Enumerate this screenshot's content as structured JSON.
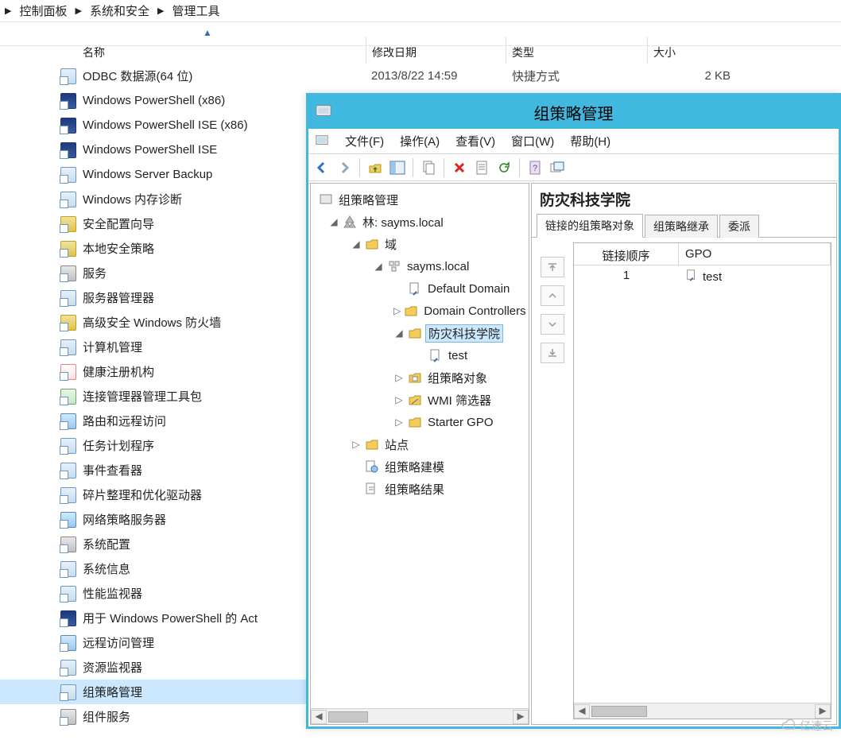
{
  "breadcrumb": [
    "控制面板",
    "系统和安全",
    "管理工具"
  ],
  "explorer": {
    "columns": {
      "name": "名称",
      "date": "修改日期",
      "type": "类型",
      "size": "大小"
    },
    "first_visible_row": {
      "name": "ODBC 数据源(64 位)",
      "date": "2013/8/22 14:59",
      "type": "快捷方式",
      "size": "2 KB"
    },
    "items": [
      "ODBC 数据源(64 位)",
      "Windows PowerShell (x86)",
      "Windows PowerShell ISE (x86)",
      "Windows PowerShell ISE",
      "Windows Server Backup",
      "Windows 内存诊断",
      "安全配置向导",
      "本地安全策略",
      "服务",
      "服务器管理器",
      "高级安全 Windows 防火墙",
      "计算机管理",
      "健康注册机构",
      "连接管理器管理工具包",
      "路由和远程访问",
      "任务计划程序",
      "事件查看器",
      "碎片整理和优化驱动器",
      "网络策略服务器",
      "系统配置",
      "系统信息",
      "性能监视器",
      "用于 Windows PowerShell 的 Act",
      "远程访问管理",
      "资源监视器",
      "组策略管理",
      "组件服务"
    ],
    "selected_index": 25
  },
  "gpmc": {
    "title": "组策略管理",
    "menu": {
      "file": "文件(F)",
      "action": "操作(A)",
      "view": "查看(V)",
      "window": "窗口(W)",
      "help": "帮助(H)"
    },
    "tree": {
      "root": "组策略管理",
      "forest": "林: sayms.local",
      "domains_container": "域",
      "domain": "sayms.local",
      "default_domain": "Default Domain",
      "domain_controllers": "Domain Controllers",
      "ou_selected": "防灾科技学院",
      "gpo_link": "test",
      "gpo_container": "组策略对象",
      "wmi": "WMI 筛选器",
      "starter": "Starter GPO",
      "sites": "站点",
      "modeling": "组策略建模",
      "results": "组策略结果"
    },
    "right": {
      "title": "防灾科技学院",
      "tabs": {
        "linked": "链接的组策略对象",
        "inherit": "组策略继承",
        "delegation": "委派"
      },
      "grid_headers": {
        "order": "链接顺序",
        "gpo": "GPO"
      },
      "grid_rows": [
        {
          "order": "1",
          "gpo": "test"
        }
      ]
    }
  },
  "watermark": "亿速云"
}
